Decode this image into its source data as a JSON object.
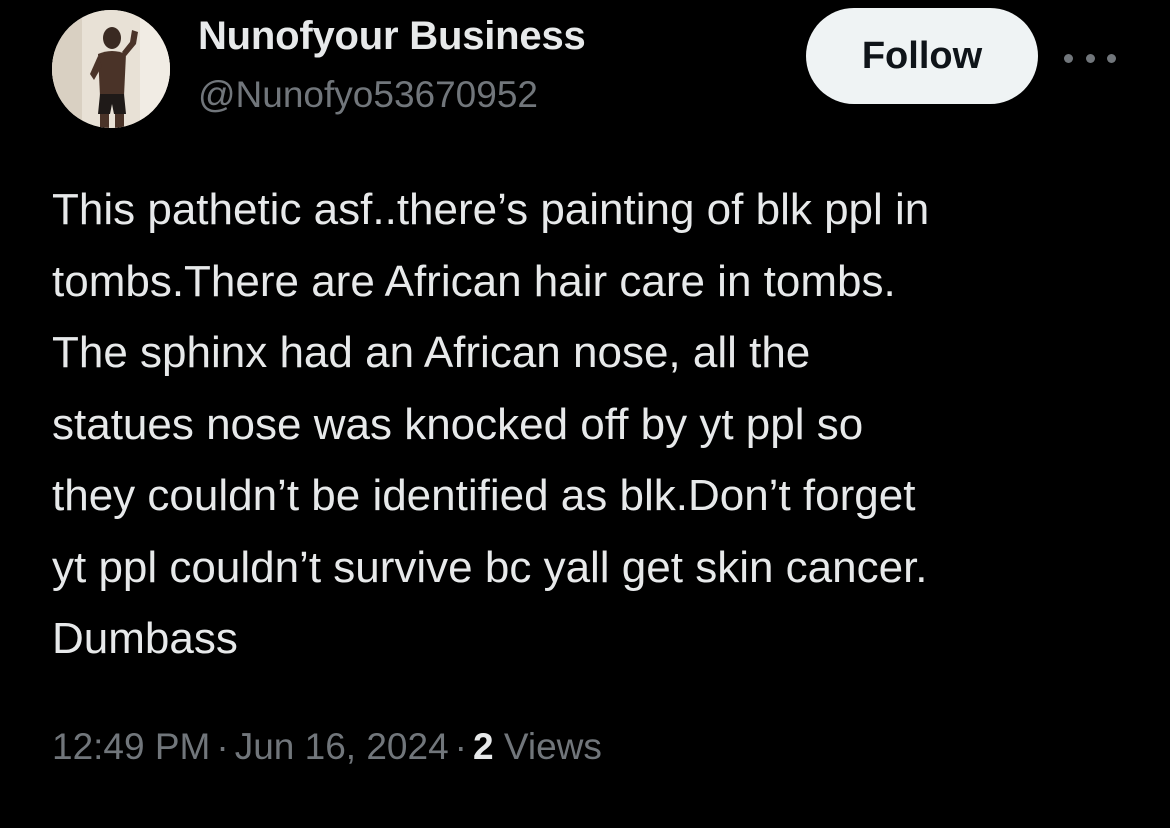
{
  "user": {
    "display_name": "Nunofyour Business",
    "handle": "@Nunofyo53670952",
    "avatar_icon": "profile-photo"
  },
  "header": {
    "follow_label": "Follow",
    "more_icon": "more-options-icon"
  },
  "tweet": {
    "lines": [
      "This pathetic asf..there’s painting of blk ppl in",
      "tombs.There are African hair care in tombs.",
      "The sphinx had an African nose, all the",
      "statues nose was knocked off by yt ppl so",
      "they couldn’t be identified as blk.Don’t forget",
      "yt ppl couldn’t survive bc yall get skin cancer.",
      "Dumbass"
    ]
  },
  "meta": {
    "time": "12:49 PM",
    "separator": "·",
    "date": "Jun 16, 2024",
    "views_count": "2",
    "views_label": "Views"
  },
  "colors": {
    "background": "#000000",
    "primary_text": "#e7e9ea",
    "secondary_text": "#71767b",
    "follow_bg": "#eff3f4",
    "follow_text": "#0f1419"
  }
}
